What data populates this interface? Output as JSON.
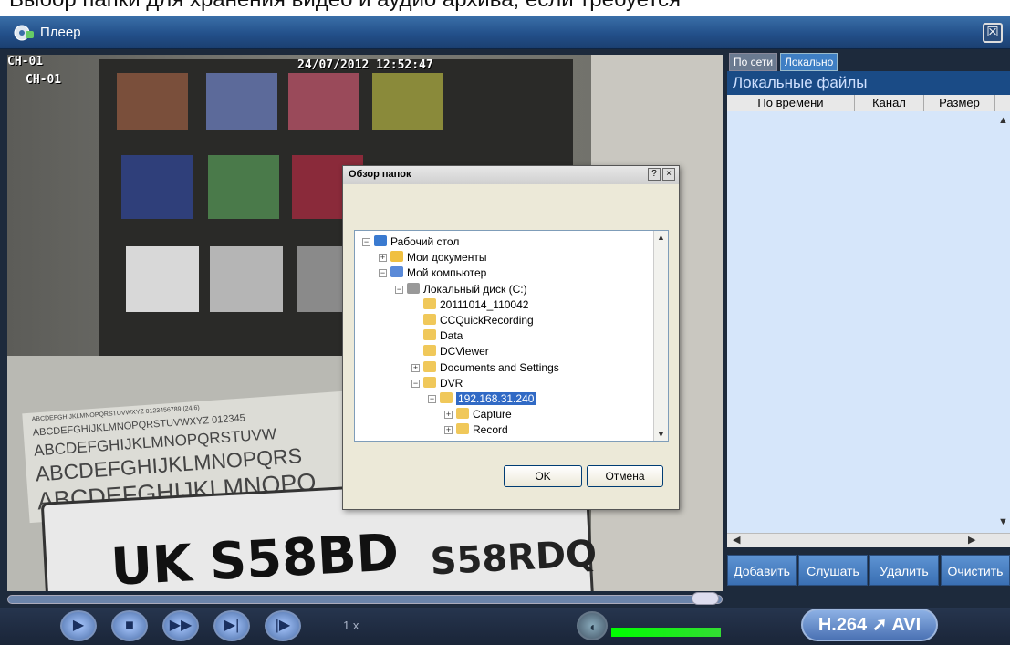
{
  "caption": "Выбор папки для хранения видео и аудио архива, если требуется",
  "window": {
    "title": "Плеер",
    "close_glyph": "☒"
  },
  "video": {
    "channel_tl": "CH-01",
    "channel_in": "CH-01",
    "timestamp": "24/07/2012 12:52:47",
    "plate_text": "UK S58BD",
    "plate_text2": "S58RDQ",
    "card_lines": [
      "ABCDEFGHIJKLMNOPQRSTUVWXYZ 0123456789 (24/6)",
      "ABCDEFGHIJKLMNOPQRSTUVWXYZ 012345",
      "ABCDEFGHIJKLMNOPQRSTUVW",
      "ABCDEFGHIJKLMNOPQRS",
      "ABCDEFGHIJKLMNOPQ"
    ]
  },
  "right_panel": {
    "tab_network": "По сети",
    "tab_local": "Локально",
    "heading": "Локальные файлы",
    "columns": [
      "По времени",
      "Канал",
      "Размер"
    ],
    "buttons": [
      "Добавить",
      "Слушать",
      "Удалить",
      "Очистить"
    ]
  },
  "controls": {
    "speed": "1 x",
    "codec_from": "H.264",
    "codec_to": "AVI"
  },
  "dialog": {
    "title": "Обзор папок",
    "help_glyph": "?",
    "close_glyph": "×",
    "ok": "OK",
    "cancel": "Отмена",
    "tree": [
      {
        "label": "Рабочий стол",
        "icon": "desktop-icon",
        "level": 0,
        "expander": "−"
      },
      {
        "label": "Мои документы",
        "icon": "documents-icon",
        "level": 1,
        "expander": "+"
      },
      {
        "label": "Мой компьютер",
        "icon": "computer-icon",
        "level": 1,
        "expander": "−"
      },
      {
        "label": "Локальный диск (C:)",
        "icon": "disk-icon",
        "level": 2,
        "expander": "−"
      },
      {
        "label": "20111014_110042",
        "icon": "folder-icon",
        "level": 3,
        "expander": ""
      },
      {
        "label": "CCQuickRecording",
        "icon": "folder-icon",
        "level": 3,
        "expander": ""
      },
      {
        "label": "Data",
        "icon": "folder-icon",
        "level": 3,
        "expander": ""
      },
      {
        "label": "DCViewer",
        "icon": "folder-icon",
        "level": 3,
        "expander": ""
      },
      {
        "label": "Documents and Settings",
        "icon": "folder-icon",
        "level": 3,
        "expander": "+"
      },
      {
        "label": "DVR",
        "icon": "folder-icon",
        "level": 3,
        "expander": "−"
      },
      {
        "label": "192.168.31.240",
        "icon": "folder-icon",
        "level": 4,
        "expander": "−",
        "selected": true
      },
      {
        "label": "Capture",
        "icon": "folder-icon",
        "level": 5,
        "expander": "+"
      },
      {
        "label": "Record",
        "icon": "folder-icon",
        "level": 5,
        "expander": "+"
      }
    ]
  },
  "colors": {
    "selection": "#316ac5",
    "panel_bg": "#d6e6fa",
    "titlebar": "#23508a"
  }
}
